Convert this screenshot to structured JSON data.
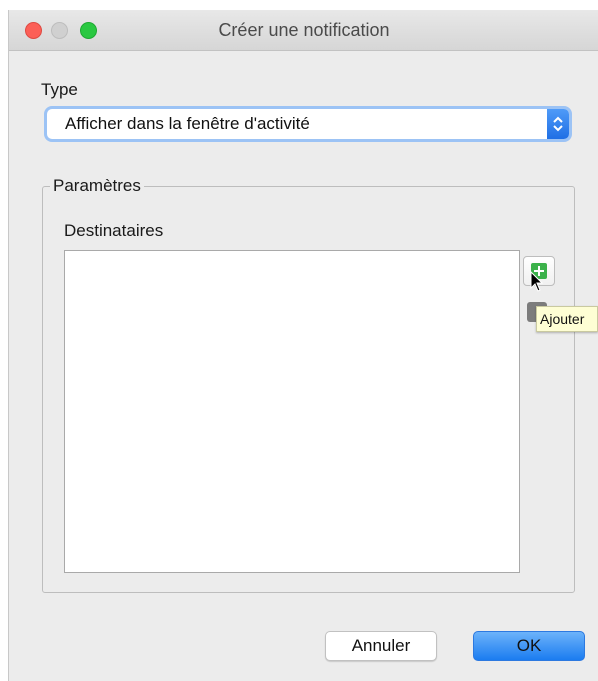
{
  "window": {
    "title": "Créer une notification"
  },
  "type_section": {
    "label": "Type",
    "selected_value": "Afficher dans la fenêtre d'activité"
  },
  "params_section": {
    "group_title": "Paramètres",
    "recipients_label": "Destinataires",
    "recipients": [],
    "add_tooltip": "Ajouter"
  },
  "footer": {
    "cancel_label": "Annuler",
    "ok_label": "OK"
  },
  "icons": {
    "add": "plus-icon",
    "remove": "minus-icon",
    "stepper": "updown-chevron-icon",
    "cursor": "mouse-pointer-icon"
  },
  "colors": {
    "accent": "#1f6fe5",
    "add_green": "#3bb14a",
    "tooltip_bg": "#fefed4"
  }
}
